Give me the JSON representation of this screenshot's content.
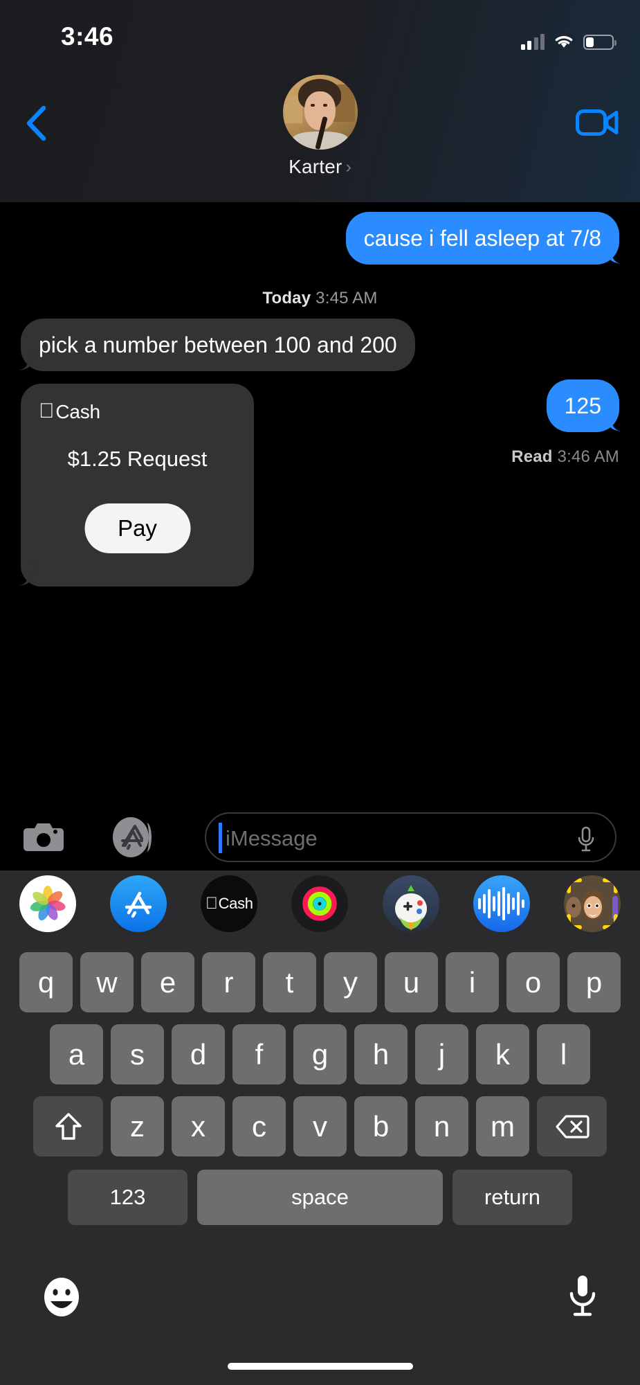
{
  "status_bar": {
    "time": "3:46",
    "cellular_bars_filled": 2,
    "cellular_bars_total": 4,
    "wifi": "wifi-icon",
    "battery_percent": 27
  },
  "nav_bar": {
    "back_icon": "chevron-left-icon",
    "contact_name": "Karter",
    "disclosure_icon": "chevron-right-icon",
    "avatar": "contact-avatar",
    "facetime_icon": "video-camera-icon"
  },
  "conversation": {
    "messages": [
      {
        "id": "m1",
        "kind": "bubble",
        "sender": "me",
        "text": "cause i fell asleep at 7/8"
      },
      {
        "id": "d1",
        "kind": "day_divider",
        "label": "Today",
        "time": "3:45 AM"
      },
      {
        "id": "m2",
        "kind": "bubble",
        "sender": "them",
        "text": "pick a number between 100 and 200"
      },
      {
        "id": "m3",
        "kind": "bubble",
        "sender": "me",
        "text": "125"
      },
      {
        "id": "r1",
        "kind": "receipt",
        "label": "Read",
        "time": "3:46 AM"
      },
      {
        "id": "m4",
        "kind": "apple_cash",
        "sender": "them",
        "brand": "Cash",
        "apple_logo": "",
        "amount_line": "$1.25 Request",
        "action": "Pay"
      }
    ]
  },
  "input_bar": {
    "camera_icon": "camera-icon",
    "apps_icon": "app-store-icon",
    "placeholder": "iMessage",
    "value": "",
    "mic_icon": "microphone-icon"
  },
  "app_drawer": {
    "apps": [
      {
        "name": "photos-app",
        "label": ""
      },
      {
        "name": "app-store-app",
        "label": ""
      },
      {
        "name": "apple-cash-app",
        "label": "Cash"
      },
      {
        "name": "fitness-app",
        "label": ""
      },
      {
        "name": "game-pigeon-app",
        "label": ""
      },
      {
        "name": "audio-message-app",
        "label": ""
      },
      {
        "name": "memoji-app",
        "label": ""
      }
    ]
  },
  "keyboard": {
    "row1": [
      "q",
      "w",
      "e",
      "r",
      "t",
      "y",
      "u",
      "i",
      "o",
      "p"
    ],
    "row2": [
      "a",
      "s",
      "d",
      "f",
      "g",
      "h",
      "j",
      "k",
      "l"
    ],
    "row3": [
      "z",
      "x",
      "c",
      "v",
      "b",
      "n",
      "m"
    ],
    "shift_icon": "shift-arrow-icon",
    "delete_icon": "delete-backspace-icon",
    "numbers_key": "123",
    "space_key": "space",
    "return_key": "return",
    "emoji_icon": "emoji-smiley-icon",
    "dictation_icon": "microphone-icon"
  },
  "colors": {
    "sent_bubble": "#2a8cff",
    "received_bubble": "#333336",
    "accent_blue": "#0a84ff",
    "keyboard_bg": "#2b2b2d",
    "key_face": "#6e6e70",
    "key_dark": "#4a4a4c"
  }
}
